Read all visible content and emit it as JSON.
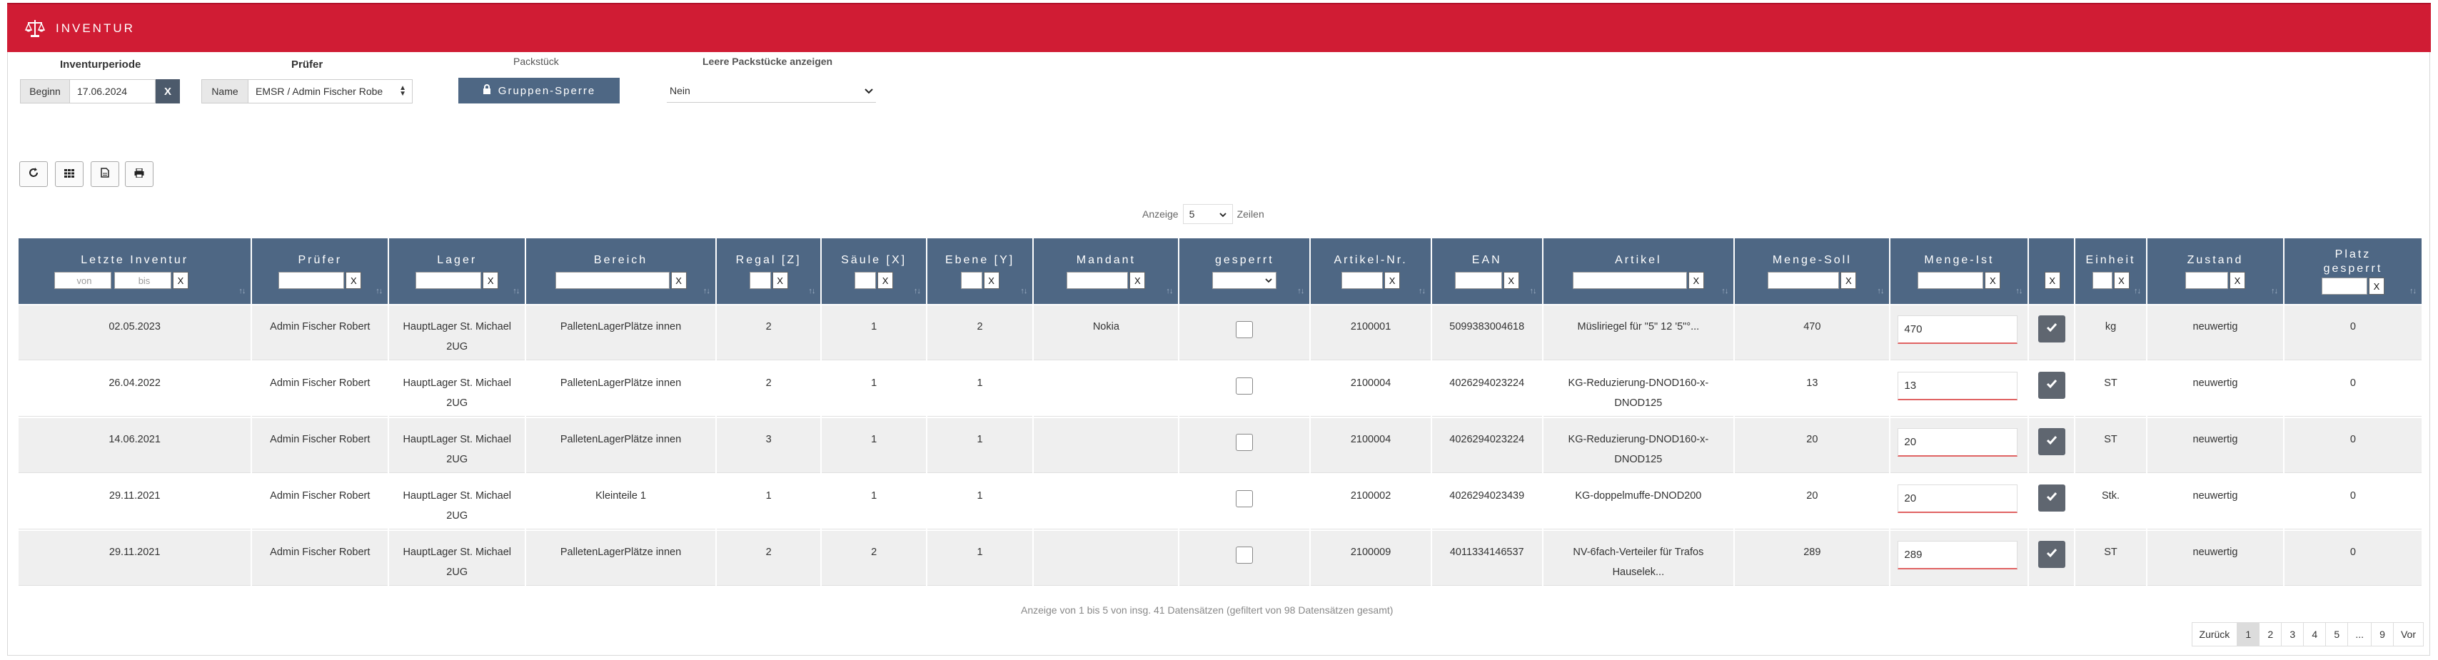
{
  "app": {
    "title": "INVENTUR"
  },
  "filters": {
    "period_label": "Inventurperiode",
    "begin_addon": "Beginn",
    "begin_value": "17.06.2024",
    "clear_label": "X",
    "pruefer_label": "Prüfer",
    "name_addon": "Name",
    "pruefer_value": "EMSR / Admin Fischer Robe",
    "packstueck_label": "Packstück",
    "group_lock_label": "Gruppen-Sperre",
    "leere_label": "Leere Packstücke anzeigen",
    "leere_value": "Nein"
  },
  "toolbar": {
    "icons": [
      "refresh-icon",
      "grid-icon",
      "document-icon",
      "print-icon"
    ]
  },
  "paging": {
    "prefix": "Anzeige",
    "size": "5",
    "suffix": "Zeilen"
  },
  "columns": {
    "letzte": "Letzte Inventur",
    "von_ph": "von",
    "bis_ph": "bis",
    "pruefer": "Prüfer",
    "lager": "Lager",
    "bereich": "Bereich",
    "regal": "Regal [Z]",
    "saeule": "Säule [X]",
    "ebene": "Ebene [Y]",
    "mandant": "Mandant",
    "gesperrt": "gesperrt",
    "artikelnr": "Artikel-Nr.",
    "ean": "EAN",
    "artikel": "Artikel",
    "soll": "Menge-Soll",
    "ist": "Menge-Ist",
    "einheit": "Einheit",
    "zustand": "Zustand",
    "platz1": "Platz",
    "platz2": "gesperrt",
    "x": "X"
  },
  "rows": [
    {
      "date": "02.05.2023",
      "pruefer": "Admin Fischer Robert",
      "lager1": "HauptLager St. Michael",
      "lager2": "2UG",
      "bereich": "PalletenLagerPlätze innen",
      "regal": "2",
      "saeule": "1",
      "ebene": "2",
      "mandant": "Nokia",
      "artnr": "2100001",
      "ean": "5099383004618",
      "artikel1": "Müsliriegel für \"5\" 12 '5\"°...",
      "artikel2": "",
      "soll": "470",
      "ist": "470",
      "einheit": "kg",
      "zustand": "neuwertig",
      "platz": "0"
    },
    {
      "date": "26.04.2022",
      "pruefer": "Admin Fischer Robert",
      "lager1": "HauptLager St. Michael",
      "lager2": "2UG",
      "bereich": "PalletenLagerPlätze innen",
      "regal": "2",
      "saeule": "1",
      "ebene": "1",
      "mandant": "",
      "artnr": "2100004",
      "ean": "4026294023224",
      "artikel1": "KG-Reduzierung-DNOD160-x-",
      "artikel2": "DNOD125",
      "soll": "13",
      "ist": "13",
      "einheit": "ST",
      "zustand": "neuwertig",
      "platz": "0"
    },
    {
      "date": "14.06.2021",
      "pruefer": "Admin Fischer Robert",
      "lager1": "HauptLager St. Michael",
      "lager2": "2UG",
      "bereich": "PalletenLagerPlätze innen",
      "regal": "3",
      "saeule": "1",
      "ebene": "1",
      "mandant": "",
      "artnr": "2100004",
      "ean": "4026294023224",
      "artikel1": "KG-Reduzierung-DNOD160-x-",
      "artikel2": "DNOD125",
      "soll": "20",
      "ist": "20",
      "einheit": "ST",
      "zustand": "neuwertig",
      "platz": "0"
    },
    {
      "date": "29.11.2021",
      "pruefer": "Admin Fischer Robert",
      "lager1": "HauptLager St. Michael",
      "lager2": "2UG",
      "bereich": "Kleinteile 1",
      "regal": "1",
      "saeule": "1",
      "ebene": "1",
      "mandant": "",
      "artnr": "2100002",
      "ean": "4026294023439",
      "artikel1": "KG-doppelmuffe-DNOD200",
      "artikel2": "",
      "soll": "20",
      "ist": "20",
      "einheit": "Stk.",
      "zustand": "neuwertig",
      "platz": "0"
    },
    {
      "date": "29.11.2021",
      "pruefer": "Admin Fischer Robert",
      "lager1": "HauptLager St. Michael",
      "lager2": "2UG",
      "bereich": "PalletenLagerPlätze innen",
      "regal": "2",
      "saeule": "2",
      "ebene": "1",
      "mandant": "",
      "artnr": "2100009",
      "ean": "4011334146537",
      "artikel1": "NV-6fach-Verteiler für Trafos",
      "artikel2": "Hauselek...",
      "soll": "289",
      "ist": "289",
      "einheit": "ST",
      "zustand": "neuwertig",
      "platz": "0"
    }
  ],
  "info": "Anzeige von 1 bis 5 von insg. 41 Datensätzen (gefiltert von 98 Datensätzen gesamt)",
  "pagination": {
    "prev": "Zurück",
    "pages": [
      "1",
      "2",
      "3",
      "4",
      "5",
      "...",
      "9"
    ],
    "next": "Vor"
  },
  "colors": {
    "brand": "#d01c34",
    "header": "#4e6784",
    "button": "#5f6670"
  }
}
